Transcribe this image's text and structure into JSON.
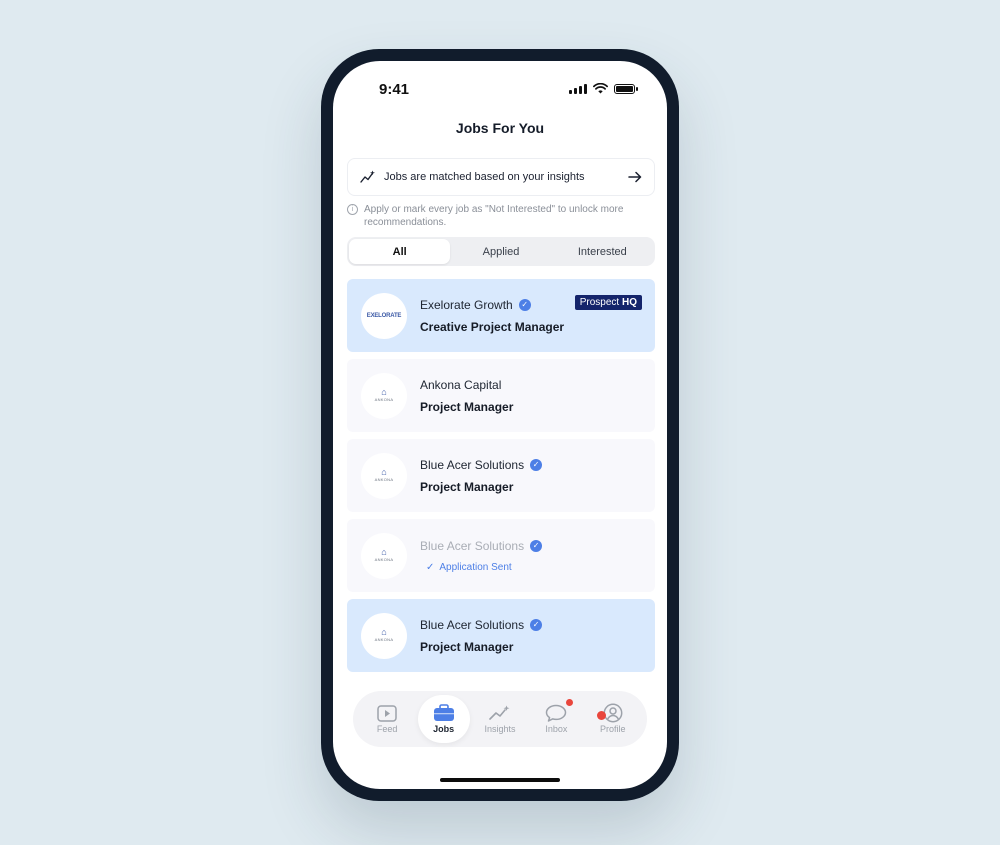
{
  "status_bar": {
    "time": "9:41"
  },
  "page_title": "Jobs For You",
  "insights_banner": {
    "text": "Jobs are matched based on your insights"
  },
  "info_note": {
    "text": "Apply or mark every job as \"Not Interested\" to unlock more recommendations."
  },
  "tabs": [
    {
      "label": "All",
      "active": true
    },
    {
      "label": "Applied",
      "active": false
    },
    {
      "label": "Interested",
      "active": false
    }
  ],
  "jobs": [
    {
      "company": "Exelorate Growth",
      "verified": true,
      "role": "Creative Project Manager",
      "logo_text": "EXELORATE",
      "badge": {
        "prefix": "Prospect",
        "suffix": "HQ"
      }
    },
    {
      "company": "Ankona Capital",
      "verified": false,
      "role": "Project Manager",
      "logo_text": "ANKONA"
    },
    {
      "company": "Blue Acer Solutions",
      "verified": true,
      "role": "Project Manager",
      "logo_text": "ANKONA"
    },
    {
      "company": "Blue Acer Solutions",
      "verified": true,
      "status": "Application Sent",
      "logo_text": "ANKONA"
    },
    {
      "company": "Blue Acer Solutions",
      "verified": true,
      "role": "Project Manager",
      "logo_text": "ANKONA"
    }
  ],
  "bottom_nav": [
    {
      "label": "Feed",
      "icon": "play-square-icon"
    },
    {
      "label": "Jobs",
      "icon": "briefcase-icon",
      "active": true
    },
    {
      "label": "Insights",
      "icon": "sparkle-chart-icon"
    },
    {
      "label": "Inbox",
      "icon": "chat-bubble-icon",
      "badge": true
    },
    {
      "label": "Profile",
      "icon": "person-circle-icon",
      "badge": true
    }
  ],
  "colors": {
    "accent": "#4d7fe6",
    "highlight_card": "#d9e9fd",
    "badge_navy": "#14246b",
    "notification_red": "#e9463c",
    "phone_frame": "#111c2c",
    "page_background": "#dfeaf0"
  }
}
